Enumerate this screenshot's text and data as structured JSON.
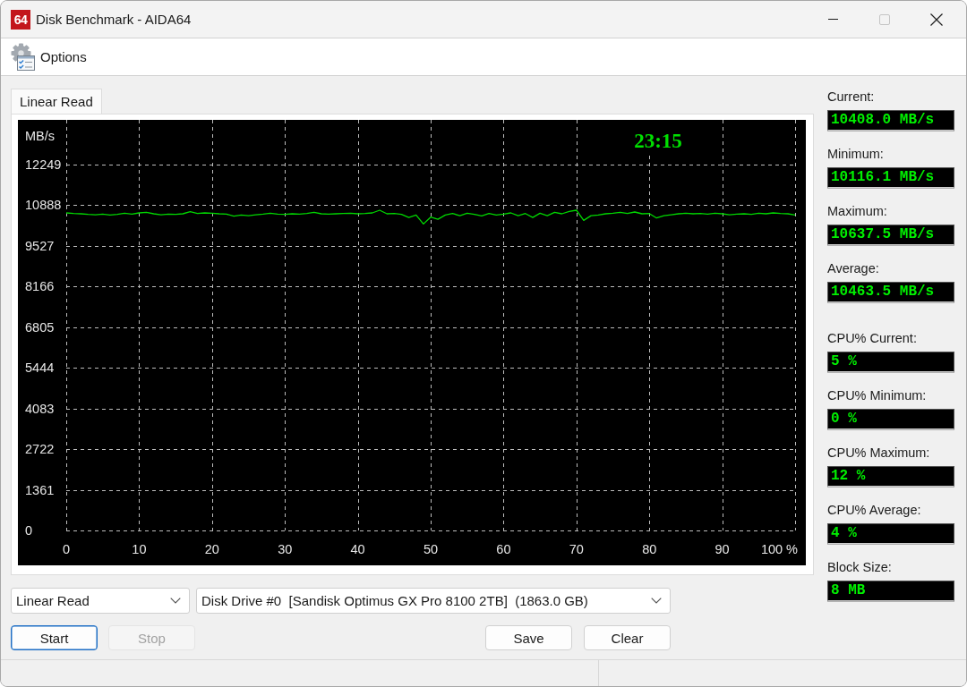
{
  "window": {
    "logo": "64",
    "title": "Disk Benchmark - AIDA64",
    "controls": [
      {
        "kind": "minimize",
        "disabled": false
      },
      {
        "kind": "maximize",
        "disabled": true
      },
      {
        "kind": "close",
        "disabled": false
      }
    ]
  },
  "toolbar": [
    {
      "label": "Options"
    }
  ],
  "tabs": [
    {
      "label": "Linear Read",
      "selected": true
    }
  ],
  "chart": {
    "elapsed_time": "23:15",
    "chart_data": {
      "type": "line",
      "ylabel": "MB/s",
      "x": [
        0,
        1,
        2,
        3,
        4,
        5,
        6,
        7,
        8,
        9,
        10,
        11,
        12,
        13,
        14,
        15,
        16,
        17,
        18,
        19,
        20,
        21,
        22,
        23,
        24,
        25,
        26,
        27,
        28,
        29,
        30,
        31,
        32,
        33,
        34,
        35,
        36,
        37,
        38,
        39,
        40,
        41,
        42,
        43,
        44,
        45,
        46,
        47,
        48,
        49,
        50,
        51,
        52,
        53,
        54,
        55,
        56,
        57,
        58,
        59,
        60,
        61,
        62,
        63,
        64,
        65,
        66,
        67,
        68,
        69,
        70,
        71,
        72,
        73,
        74,
        75,
        76,
        77,
        78,
        79,
        80,
        81,
        82,
        83,
        84,
        85,
        86,
        87,
        88,
        89,
        90,
        91,
        92,
        93,
        94,
        95,
        96,
        97,
        98,
        99,
        100
      ],
      "series": [
        {
          "color": "#00d800",
          "values": [
            10630,
            10610,
            10600,
            10580,
            10570,
            10590,
            10560,
            10580,
            10620,
            10590,
            10630,
            10650,
            10600,
            10570,
            10590,
            10580,
            10600,
            10670,
            10610,
            10630,
            10620,
            10600,
            10590,
            10520,
            10560,
            10540,
            10570,
            10590,
            10620,
            10590,
            10580,
            10600,
            10590,
            10610,
            10650,
            10600,
            10590,
            10600,
            10610,
            10620,
            10600,
            10610,
            10630,
            10720,
            10600,
            10610,
            10580,
            10480,
            10560,
            10260,
            10490,
            10420,
            10560,
            10610,
            10540,
            10620,
            10580,
            10530,
            10610,
            10560,
            10590,
            10630,
            10540,
            10610,
            10480,
            10620,
            10540,
            10650,
            10600,
            10680,
            10720,
            10380,
            10540,
            10560,
            10600,
            10620,
            10650,
            10610,
            10660,
            10600,
            10610,
            10460,
            10540,
            10570,
            10600,
            10620,
            10600,
            10610,
            10590,
            10620,
            10600,
            10570,
            10590,
            10600,
            10580,
            10620,
            10600,
            10630,
            10610,
            10600,
            10560
          ]
        }
      ],
      "xlim": [
        0,
        100
      ],
      "ylim": [
        0,
        13746
      ],
      "xticks": [
        0,
        10,
        20,
        30,
        40,
        50,
        60,
        70,
        80,
        90,
        {
          "value": 100,
          "label": "100 %"
        }
      ],
      "yticks": [
        0,
        1361,
        2722,
        4083,
        5444,
        6805,
        8166,
        9527,
        10888,
        12249
      ],
      "grid": true
    }
  },
  "stats": [
    {
      "label": "Current:",
      "value": "10408.0 MB/s"
    },
    {
      "label": "Minimum:",
      "value": "10116.1 MB/s"
    },
    {
      "label": "Maximum:",
      "value": "10637.5 MB/s"
    },
    {
      "label": "Average:",
      "value": "10463.5 MB/s"
    }
  ],
  "cpu_stats": [
    {
      "label": "CPU% Current:",
      "value": "5 %"
    },
    {
      "label": "CPU% Minimum:",
      "value": "0 %"
    },
    {
      "label": "CPU% Maximum:",
      "value": "12 %"
    },
    {
      "label": "CPU% Average:",
      "value": "4 %"
    }
  ],
  "block_size": {
    "label": "Block Size:",
    "value": "8 MB"
  },
  "test_select": {
    "value": "Linear Read"
  },
  "drive_select": {
    "value": "Disk Drive #0  [Sandisk Optimus GX Pro 8100 2TB]  (1863.0 GB)"
  },
  "buttons": [
    {
      "label": "Start",
      "default": true,
      "disabled": false
    },
    {
      "label": "Stop",
      "default": false,
      "disabled": true
    },
    {
      "label": "Save",
      "default": false,
      "disabled": false
    },
    {
      "label": "Clear",
      "default": false,
      "disabled": false
    }
  ]
}
